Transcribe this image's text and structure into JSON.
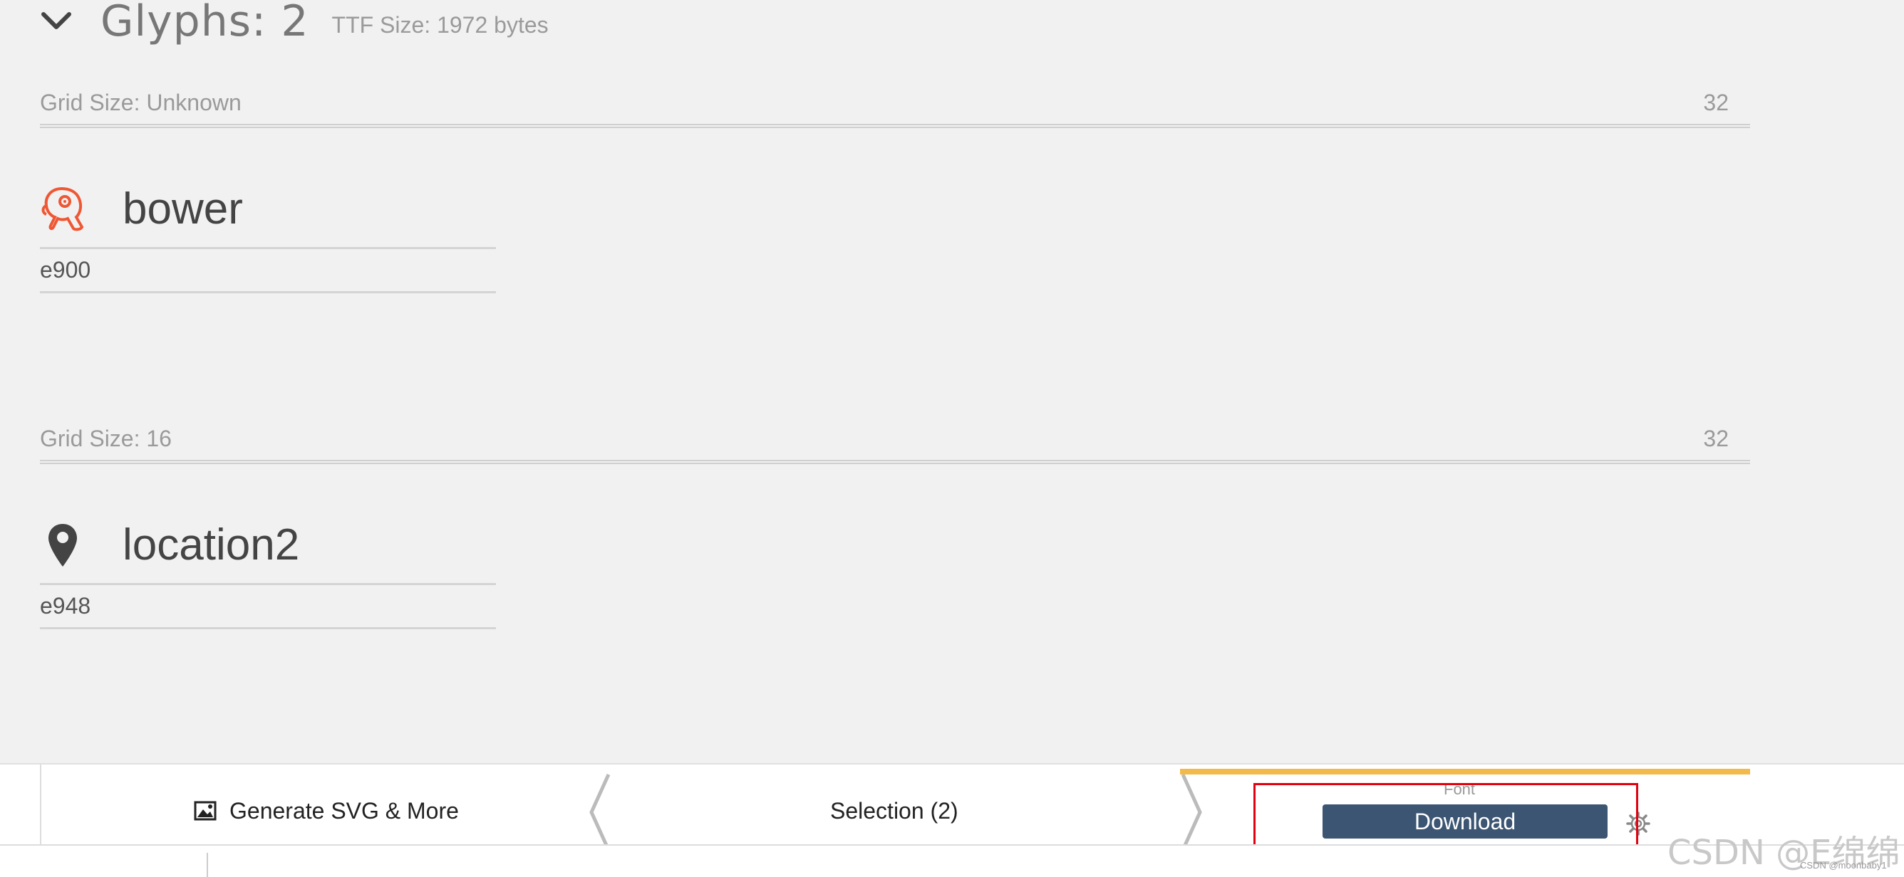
{
  "header": {
    "title": "Glyphs: 2",
    "ttf_size": "TTF Size: 1972 bytes"
  },
  "sets": [
    {
      "grid_label": "Grid Size: Unknown",
      "grid_value": "32",
      "glyph": {
        "name": "bower",
        "code": "e900",
        "icon": "bower-icon",
        "color": "#ef5734"
      }
    },
    {
      "grid_label": "Grid Size: 16",
      "grid_value": "32",
      "glyph": {
        "name": "location2",
        "code": "e948",
        "icon": "location-pin-icon",
        "color": "#444444"
      }
    }
  ],
  "footer": {
    "generate_label": "Generate SVG & More",
    "selection_label": "Selection (2)",
    "font_label": "Font",
    "download_label": "Download",
    "accent_color": "#f2b94b",
    "download_color": "#3b5572",
    "highlight_color": "#e3000f"
  },
  "watermark": {
    "main": "CSDN @E绵绵",
    "small": "CSDN @moonbaby1"
  }
}
